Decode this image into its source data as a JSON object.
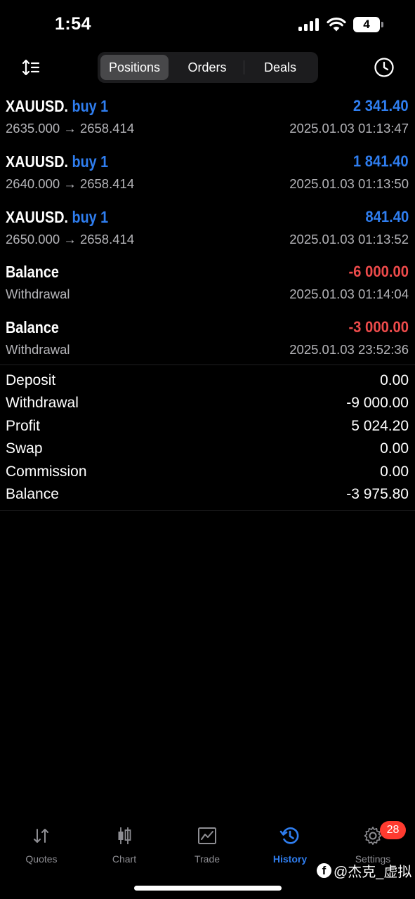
{
  "status_bar": {
    "time": "1:54",
    "battery": "4"
  },
  "header": {
    "tabs": [
      {
        "label": "Positions",
        "active": true
      },
      {
        "label": "Orders",
        "active": false
      },
      {
        "label": "Deals",
        "active": false
      }
    ]
  },
  "deals": [
    {
      "symbol": "XAUUSD.",
      "type": "buy 1",
      "amount": "2 341.40",
      "detail": "2635.000 → 2658.414",
      "time": "2025.01.03 01:13:47"
    },
    {
      "symbol": "XAUUSD.",
      "type": "buy 1",
      "amount": "1 841.40",
      "detail": "2640.000 → 2658.414",
      "time": "2025.01.03 01:13:50"
    },
    {
      "symbol": "XAUUSD.",
      "type": "buy 1",
      "amount": "841.40",
      "detail": "2650.000 → 2658.414",
      "time": "2025.01.03 01:13:52"
    },
    {
      "symbol": "Balance",
      "type": "",
      "amount": "-6 000.00",
      "detail": "Withdrawal",
      "time": "2025.01.03 01:14:04"
    },
    {
      "symbol": "Balance",
      "type": "",
      "amount": "-3 000.00",
      "detail": "Withdrawal",
      "time": "2025.01.03 23:52:36"
    }
  ],
  "summary": [
    {
      "label": "Deposit",
      "value": "0.00"
    },
    {
      "label": "Withdrawal",
      "value": "-9 000.00"
    },
    {
      "label": "Profit",
      "value": "5 024.20"
    },
    {
      "label": "Swap",
      "value": "0.00"
    },
    {
      "label": "Commission",
      "value": "0.00"
    },
    {
      "label": "Balance",
      "value": "-3 975.80"
    }
  ],
  "tabbar": {
    "items": [
      {
        "label": "Quotes",
        "icon": "quotes-icon",
        "active": false
      },
      {
        "label": "Chart",
        "icon": "candlestick-icon",
        "active": false
      },
      {
        "label": "Trade",
        "icon": "trade-icon",
        "active": false
      },
      {
        "label": "History",
        "icon": "history-icon",
        "active": true
      },
      {
        "label": "Settings",
        "icon": "gear-icon",
        "active": false
      }
    ],
    "settings_badge": "28"
  },
  "watermark": {
    "text": "@杰克_虚拟"
  },
  "colors": {
    "accent": "#2f7ef0",
    "negative": "#ee4b4b",
    "background": "#000000"
  }
}
